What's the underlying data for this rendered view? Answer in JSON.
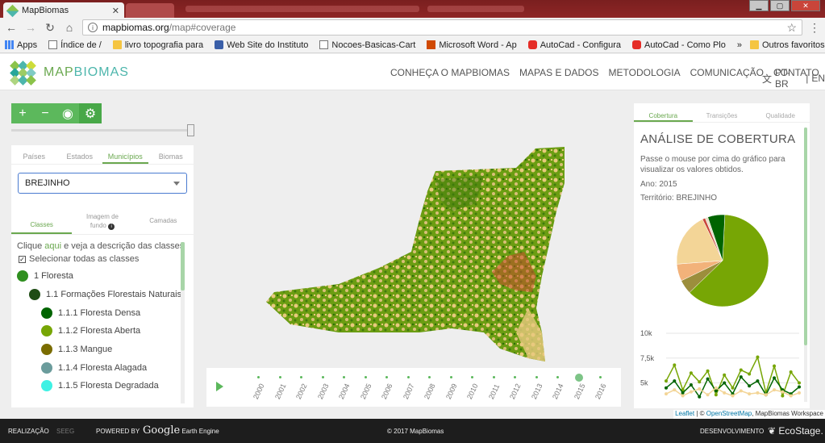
{
  "browser": {
    "tab_title": "MapBiomas",
    "url_host": "mapbiomas.org",
    "url_path": "/map#coverage",
    "bookmarks": [
      {
        "label": "Apps",
        "icon": "apps-icon"
      },
      {
        "label": "Índice de /",
        "icon": "document-icon"
      },
      {
        "label": "livro topografia para",
        "icon": "folder-icon"
      },
      {
        "label": "Web Site do Instituto",
        "icon": "pen-icon"
      },
      {
        "label": "Nocoes-Basicas-Cart",
        "icon": "document-icon"
      },
      {
        "label": "Microsoft Word - Ap",
        "icon": "office-icon"
      },
      {
        "label": "AutoCad - Configura",
        "icon": "youtube-icon"
      },
      {
        "label": "AutoCad - Como Plo",
        "icon": "youtube-icon"
      }
    ],
    "more": "»",
    "other_favorites": "Outros favoritos"
  },
  "header": {
    "logo_a": "MAP",
    "logo_b": "BIOMAS",
    "nav": [
      "CONHEÇA O MAPBIOMAS",
      "MAPAS E DADOS",
      "METODOLOGIA",
      "COMUNICAÇÃO",
      "CONTATO"
    ],
    "lang_pt": "PT-BR",
    "lang_sep": "|",
    "lang_en": "EN"
  },
  "left": {
    "tabs": [
      "Países",
      "Estados",
      "Municípios",
      "Biomas"
    ],
    "active_tab": 2,
    "selected_territory": "BREJINHO",
    "subtabs": {
      "classes": "Classes",
      "background_l1": "Imagem de",
      "background_l2": "fundo",
      "layers": "Camadas"
    },
    "help_prefix": "Clique ",
    "help_link": "aqui",
    "help_suffix": " e veja a descrição das classes",
    "select_all": "Selecionar todas as classes",
    "classes": [
      {
        "label": "1 Floresta",
        "color": "#2f8f1f",
        "indent": 0
      },
      {
        "label": "1.1 Formações Florestais Naturais",
        "color": "#1f4d15",
        "indent": 1
      },
      {
        "label": "1.1.1 Floresta Densa",
        "color": "#006400",
        "indent": 2
      },
      {
        "label": "1.1.2 Floresta Aberta",
        "color": "#77a605",
        "indent": 2
      },
      {
        "label": "1.1.3 Mangue",
        "color": "#7a6c00",
        "indent": 2
      },
      {
        "label": "1.1.4 Floresta Alagada",
        "color": "#6b9c9c",
        "indent": 2
      },
      {
        "label": "1.1.5 Floresta Degradada",
        "color": "#3ef1e4",
        "indent": 2
      }
    ]
  },
  "timeline": {
    "years": [
      "2000",
      "2001",
      "2002",
      "2003",
      "2004",
      "2005",
      "2006",
      "2007",
      "2008",
      "2009",
      "2010",
      "2011",
      "2012",
      "2013",
      "2014",
      "2015",
      "2016"
    ],
    "selected": "2015"
  },
  "right": {
    "tabs": [
      "Cobertura",
      "Transições",
      "Qualidade"
    ],
    "title": "ANÁLISE DE COBERTURA",
    "desc": "Passe o mouse por cima do gráfico para visualizar os valores obtidos.",
    "year_line": "Ano: 2015",
    "territory_line": "Território: BREJINHO"
  },
  "chart_data": [
    {
      "type": "pie",
      "title": "",
      "slices": [
        {
          "value": 62,
          "color": "#77a605"
        },
        {
          "value": 5,
          "color": "#9c8e3c"
        },
        {
          "value": 6,
          "color": "#f2b27a"
        },
        {
          "value": 19,
          "color": "#f3d597"
        },
        {
          "value": 1,
          "color": "#c9483b"
        },
        {
          "value": 1,
          "color": "#e8e0c8"
        },
        {
          "value": 6,
          "color": "#006400"
        }
      ]
    },
    {
      "type": "line",
      "title": "",
      "ytick_labels": [
        "10k",
        "7,5k",
        "5k"
      ],
      "ylim": [
        3500,
        10000
      ],
      "series": [
        {
          "color": "#77a605",
          "values": [
            5200,
            6800,
            4300,
            6000,
            5100,
            6200,
            3800,
            5800,
            4500,
            6300,
            5900,
            7600,
            4000,
            6700,
            3700,
            6100,
            5000
          ]
        },
        {
          "color": "#006400",
          "values": [
            4500,
            5200,
            4000,
            4800,
            3600,
            5400,
            4200,
            5000,
            3900,
            5600,
            4700,
            5200,
            3800,
            5500,
            4300,
            3900,
            4600
          ]
        },
        {
          "color": "#f3d597",
          "values": [
            3900,
            4300,
            3700,
            4100,
            4400,
            3800,
            4500,
            4000,
            3700,
            4200,
            3900,
            4000,
            3800,
            4300,
            4100,
            3700,
            4000
          ]
        }
      ]
    }
  ],
  "map_attr": {
    "leaflet": "Leaflet",
    "sep": " | © ",
    "osm": "OpenStreetMap",
    "rest": ", MapBiomas Workspace"
  },
  "footer": {
    "realizacao": "REALIZAÇÃO",
    "seeg": "SEEG",
    "powered": "POWERED BY",
    "google": "Google",
    "earth_engine": "Earth Engine",
    "copyright": "© 2017 MapBiomas",
    "desenvolvimento": "DESENVOLVIMENTO",
    "ecostage": "EcoStage."
  }
}
